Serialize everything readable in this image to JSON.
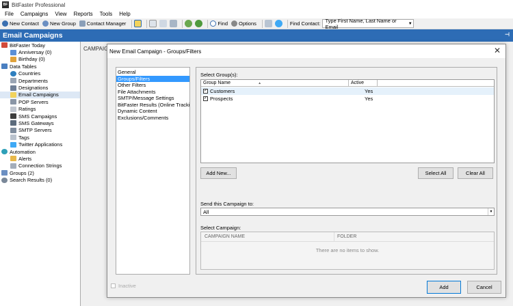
{
  "app": {
    "logo": "BF",
    "title": "BitFaster Professional"
  },
  "menu": [
    "File",
    "Campaigns",
    "View",
    "Reports",
    "Tools",
    "Help"
  ],
  "toolbar": {
    "new_contact": "New Contact",
    "new_group": "New Group",
    "contact_manager": "Contact Manager",
    "find": "Find",
    "options": "Options",
    "find_contact_label": "Find Contact:",
    "find_contact_value": "Type First Name, Last Name or Email"
  },
  "section": {
    "title": "Email Campaigns"
  },
  "tree": [
    {
      "label": "BitFaster Today",
      "level": 0
    },
    {
      "label": "Anniversay (0)",
      "level": 1
    },
    {
      "label": "Birthday (0)",
      "level": 1
    },
    {
      "label": "Data Tables",
      "level": 0
    },
    {
      "label": "Countries",
      "level": 1
    },
    {
      "label": "Departments",
      "level": 1
    },
    {
      "label": "Designations",
      "level": 1
    },
    {
      "label": "Email Campaigns",
      "level": 1
    },
    {
      "label": "POP Servers",
      "level": 1
    },
    {
      "label": "Ratings",
      "level": 1
    },
    {
      "label": "SMS Campaigns",
      "level": 1
    },
    {
      "label": "SMS Gateways",
      "level": 1
    },
    {
      "label": "SMTP Servers",
      "level": 1
    },
    {
      "label": "Tags",
      "level": 1
    },
    {
      "label": "Twitter Applications",
      "level": 1
    },
    {
      "label": "Automation",
      "level": 0
    },
    {
      "label": "Alerts",
      "level": 1
    },
    {
      "label": "Connection Strings",
      "level": 1
    },
    {
      "label": "Groups (2)",
      "level": 0
    },
    {
      "label": "Search Results (0)",
      "level": 0
    }
  ],
  "main": {
    "column_header": "CAMPAIG"
  },
  "dialog": {
    "title": "New Email Campaign - Groups/Filters",
    "nav": [
      "General",
      "Groups/Filters",
      "Other Filters",
      "File Attachments",
      "SMTP/Message Settings",
      "BitFaster Results (Online Tracki...",
      "Dynamic Content",
      "Exclusions/Comments"
    ],
    "select_groups_label": "Select Group(s):",
    "groups_columns": {
      "name": "Group Name",
      "active": "Active"
    },
    "groups": [
      {
        "name": "Customers",
        "active": "Yes",
        "checked": true
      },
      {
        "name": "Prospects",
        "active": "Yes",
        "checked": true
      }
    ],
    "add_new": "Add New...",
    "select_all": "Select All",
    "clear_all": "Clear All",
    "send_to_label": "Send this Campaign to:",
    "send_to_value": "All",
    "select_campaign_label": "Select Campaign:",
    "campaign_columns": {
      "name": "CAMPAIGN NAME",
      "folder": "FOLDER"
    },
    "campaign_empty": "There are no items to show.",
    "inactive_label": "Inactive",
    "add": "Add",
    "cancel": "Cancel"
  }
}
